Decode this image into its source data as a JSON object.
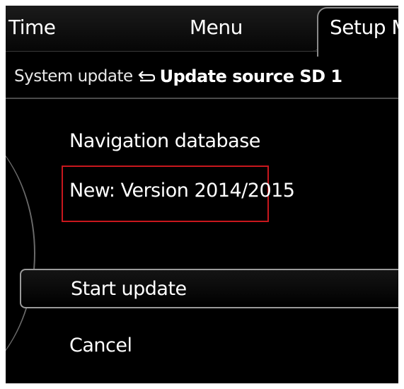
{
  "tabs": {
    "time": "Time",
    "menu": "Menu",
    "setup": "Setup MMI"
  },
  "breadcrumb": {
    "parent": "System update",
    "icon": "back-arrow-icon",
    "current": "Update source SD 1"
  },
  "content": {
    "heading": "Navigation database",
    "new_version": "New: Version 2014/2015"
  },
  "menu_items": [
    {
      "label": "Start update"
    },
    {
      "label": "Cancel"
    }
  ],
  "colors": {
    "background": "#000000",
    "highlight_box": "#c8171d",
    "text": "#ffffff"
  }
}
